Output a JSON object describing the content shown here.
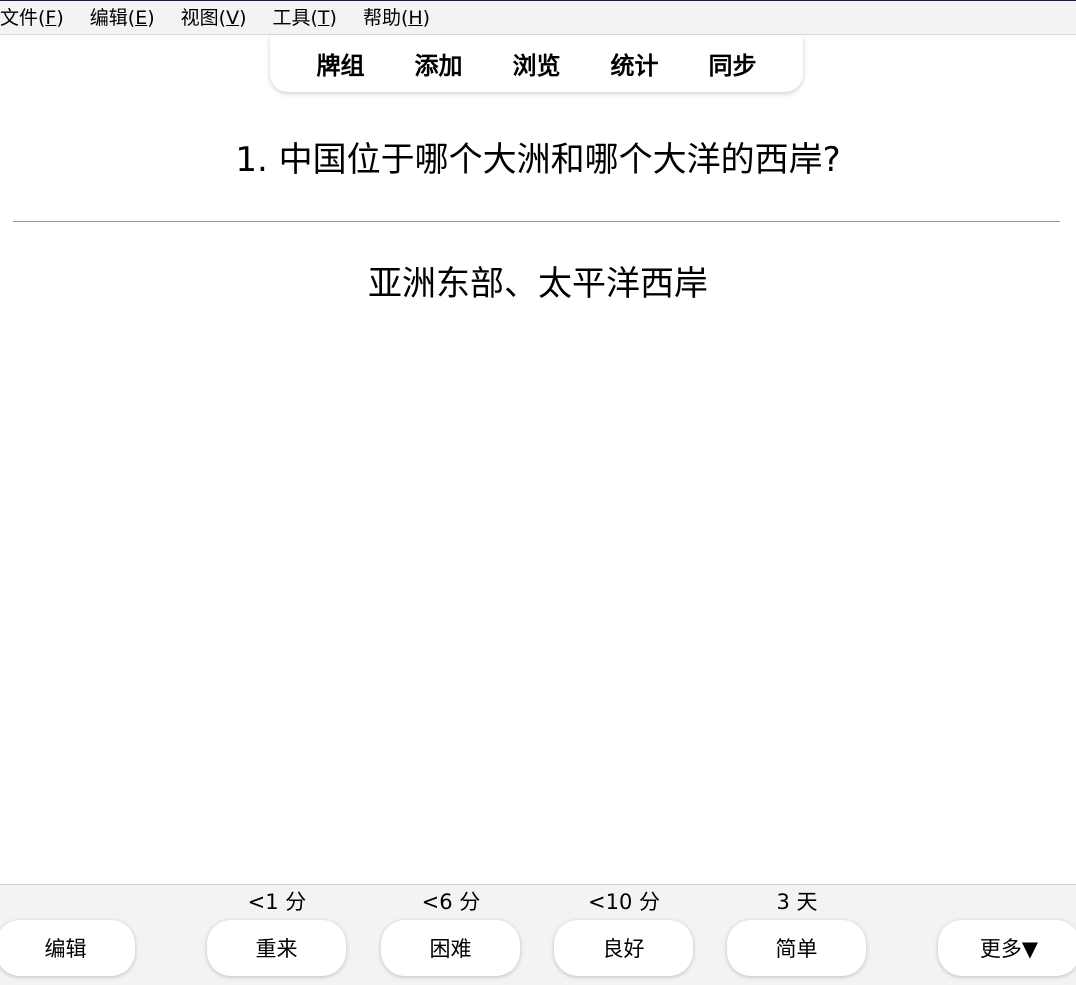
{
  "menubar": {
    "items": [
      {
        "label": "文件(",
        "key": "F",
        "suffix": ")"
      },
      {
        "label": "编辑(",
        "key": "E",
        "suffix": ")"
      },
      {
        "label": "视图(",
        "key": "V",
        "suffix": ")"
      },
      {
        "label": "工具(",
        "key": "T",
        "suffix": ")"
      },
      {
        "label": "帮助(",
        "key": "H",
        "suffix": ")"
      }
    ]
  },
  "toolbar": {
    "decks": "牌组",
    "add": "添加",
    "browse": "浏览",
    "stats": "统计",
    "sync": "同步"
  },
  "card": {
    "question": "1. 中国位于哪个大洲和哪个大洋的西岸?",
    "answer": "亚洲东部、太平洋西岸"
  },
  "bottombar": {
    "edit_label": "编辑",
    "again": {
      "interval": "<1 分",
      "label": "重来"
    },
    "hard": {
      "interval": "<6 分",
      "label": "困难"
    },
    "good": {
      "interval": "<10 分",
      "label": "良好"
    },
    "easy": {
      "interval": "3 天",
      "label": "简单"
    },
    "more_label": "更多▼"
  }
}
